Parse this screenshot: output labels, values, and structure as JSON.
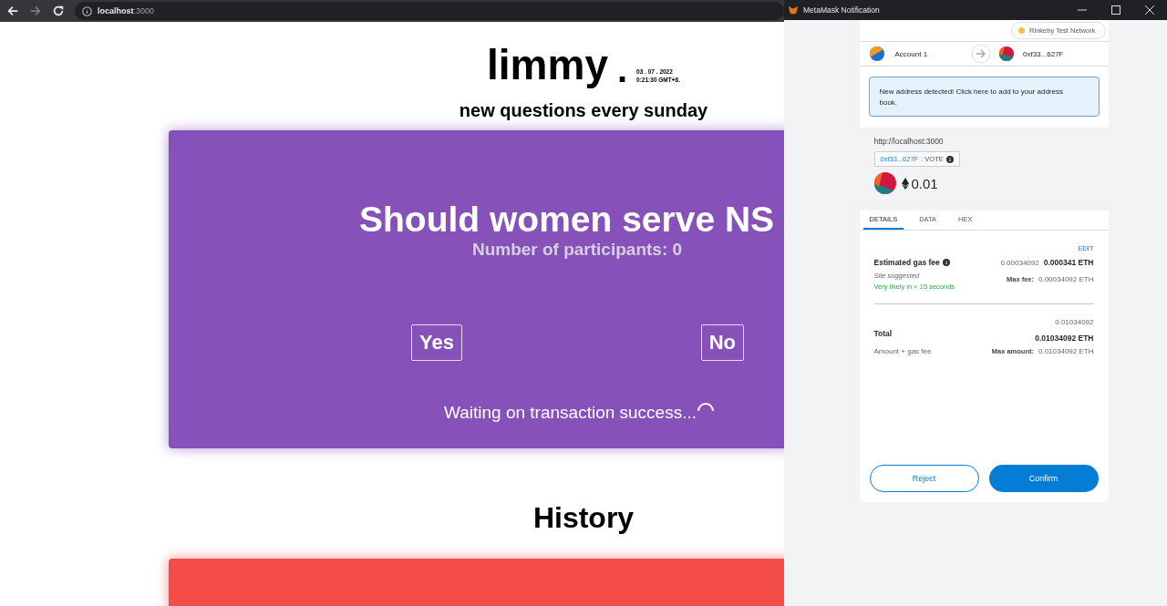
{
  "browser": {
    "url_host": "localhost",
    "url_port": ":3000",
    "forward_disabled": true
  },
  "site": {
    "logo": "limmy",
    "logo_dot": ".",
    "date_line_1": "03 . 07 . 2022",
    "date_line_2": "0:21:30 GMT+8.",
    "tagline": "new questions every sunday",
    "question": {
      "title": "Should women serve NS",
      "participants": "Number of participants: 0",
      "options": [
        "Yes",
        "No"
      ],
      "status": "Waiting on transaction success...",
      "loading": true
    },
    "history_title": "History"
  },
  "metamask": {
    "window_title": "MetaMask Notification",
    "network": {
      "label": "Rinkeby Test Network",
      "color": "#f6c343"
    },
    "from_account": "Account 1",
    "to_account": "0xf33...627F",
    "alert": "New address detected! Click here to add to your address book.",
    "origin": "http://localhost:3000",
    "contract": "0xf33...627F",
    "method": ": VOTE",
    "amount": "0.01",
    "tabs": [
      {
        "label": "DETAILS",
        "selected": true
      },
      {
        "label": "DATA",
        "selected": false
      },
      {
        "label": "HEX",
        "selected": false
      }
    ],
    "edit": "EDIT",
    "gas": {
      "label": "Estimated gas fee",
      "value_secondary": "0.00034092",
      "value_primary": "0.000341 ETH",
      "site_suggested": "Site suggested",
      "likely": "Very likely in < 15 seconds",
      "max_fee_label": "Max fee:",
      "max_fee_value": "0.00034092 ETH"
    },
    "total": {
      "label": "Total",
      "value_secondary": "0.01034092",
      "value_primary": "0.01034092 ETH",
      "sublabel": "Amount + gas fee",
      "max_amount_label": "Max amount:",
      "max_amount_value": "0.01034092 ETH"
    },
    "buttons": {
      "reject": "Reject",
      "confirm": "Confirm"
    }
  }
}
